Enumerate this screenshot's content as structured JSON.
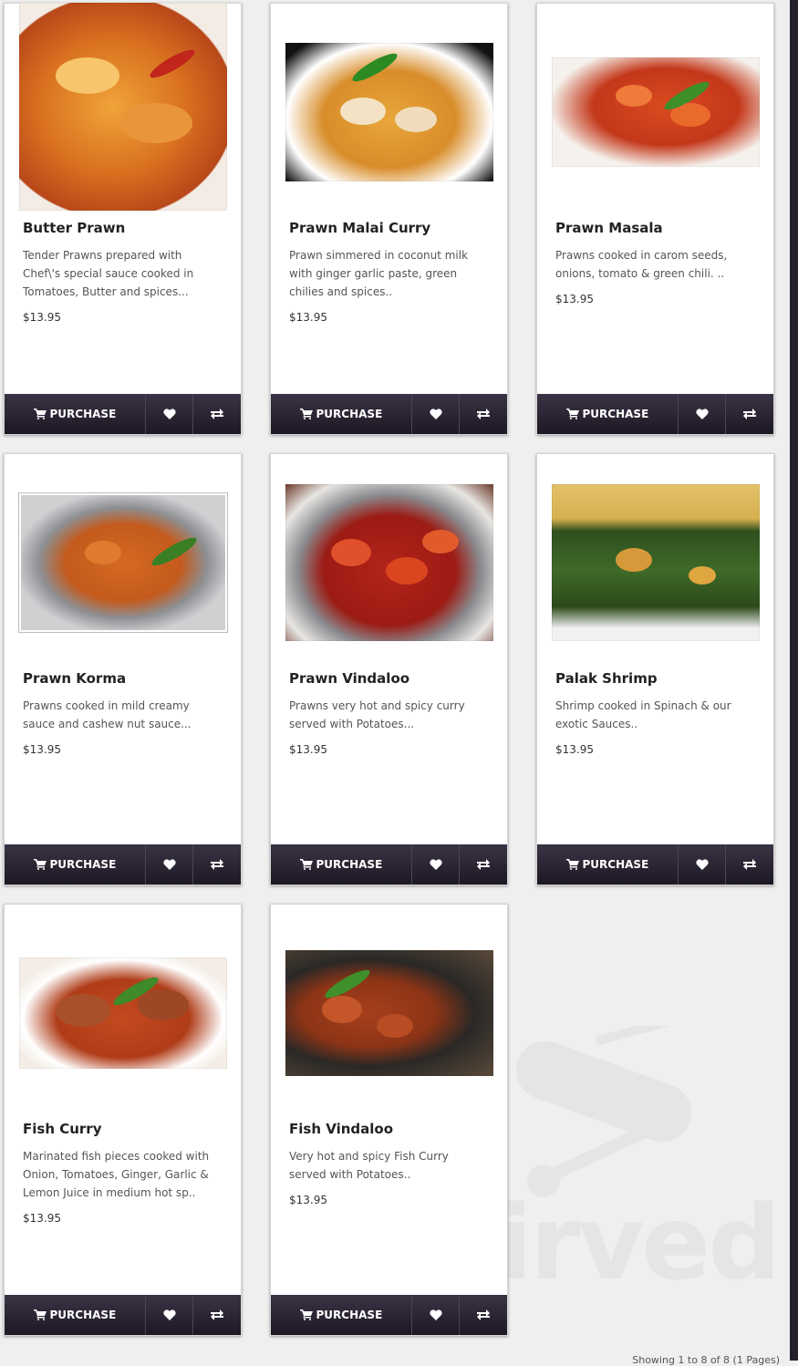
{
  "colors": {
    "bar_top": "#3a3345",
    "bar_bottom": "#1d1824",
    "page_bg": "#efefef"
  },
  "actions": {
    "purchase_label": "PURCHASE",
    "cart_icon": "shopping-cart-icon",
    "wishlist_icon": "heart-icon",
    "compare_icon": "exchange-arrows-icon"
  },
  "watermark": {
    "text": "sirved"
  },
  "footer": {
    "text": "Showing 1 to 8 of 8 (1 Pages)"
  },
  "products": [
    {
      "name": "Butter Prawn",
      "description": "Tender Prawns prepared with Chef\\'s special sauce cooked in Tomatoes, Butter and spices...",
      "price": "$13.95",
      "image": "butter-prawn-photo"
    },
    {
      "name": "Prawn Malai Curry",
      "description": "Prawn simmered in coconut milk with ginger garlic paste, green chilies and spices..",
      "price": "$13.95",
      "image": "prawn-malai-curry-photo"
    },
    {
      "name": "Prawn Masala",
      "description": "Prawns cooked in carom seeds, onions, tomato & green chili. ..",
      "price": "$13.95",
      "image": "prawn-masala-photo"
    },
    {
      "name": "Prawn Korma",
      "description": "Prawns cooked in mild creamy sauce and cashew nut sauce...",
      "price": "$13.95",
      "image": "prawn-korma-photo"
    },
    {
      "name": "Prawn Vindaloo",
      "description": "Prawns very hot and spicy curry served with Potatoes...",
      "price": "$13.95",
      "image": "prawn-vindaloo-photo"
    },
    {
      "name": "Palak Shrimp",
      "description": "Shrimp cooked in Spinach & our exotic Sauces..",
      "price": "$13.95",
      "image": "palak-shrimp-photo"
    },
    {
      "name": "Fish Curry",
      "description": "Marinated fish pieces cooked with Onion, Tomatoes, Ginger, Garlic & Lemon Juice in medium hot sp..",
      "price": "$13.95",
      "image": "fish-curry-photo"
    },
    {
      "name": "Fish Vindaloo",
      "description": "Very hot and spicy Fish Curry served with Potatoes..",
      "price": "$13.95",
      "image": "fish-vindaloo-photo"
    }
  ]
}
